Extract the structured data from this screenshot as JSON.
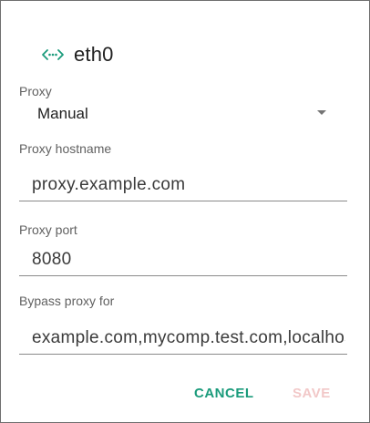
{
  "dialog": {
    "title": "eth0",
    "title_icon": "ethernet-icon",
    "accent_color": "#1a9b7b"
  },
  "proxy": {
    "label": "Proxy",
    "selected": "Manual"
  },
  "hostname": {
    "label": "Proxy hostname",
    "value": "proxy.example.com"
  },
  "port": {
    "label": "Proxy port",
    "value": "8080"
  },
  "bypass": {
    "label": "Bypass proxy for",
    "value": "example.com,mycomp.test.com,localhost"
  },
  "actions": {
    "cancel_label": "CANCEL",
    "save_label": "SAVE",
    "save_color": "#f2c8c8"
  }
}
